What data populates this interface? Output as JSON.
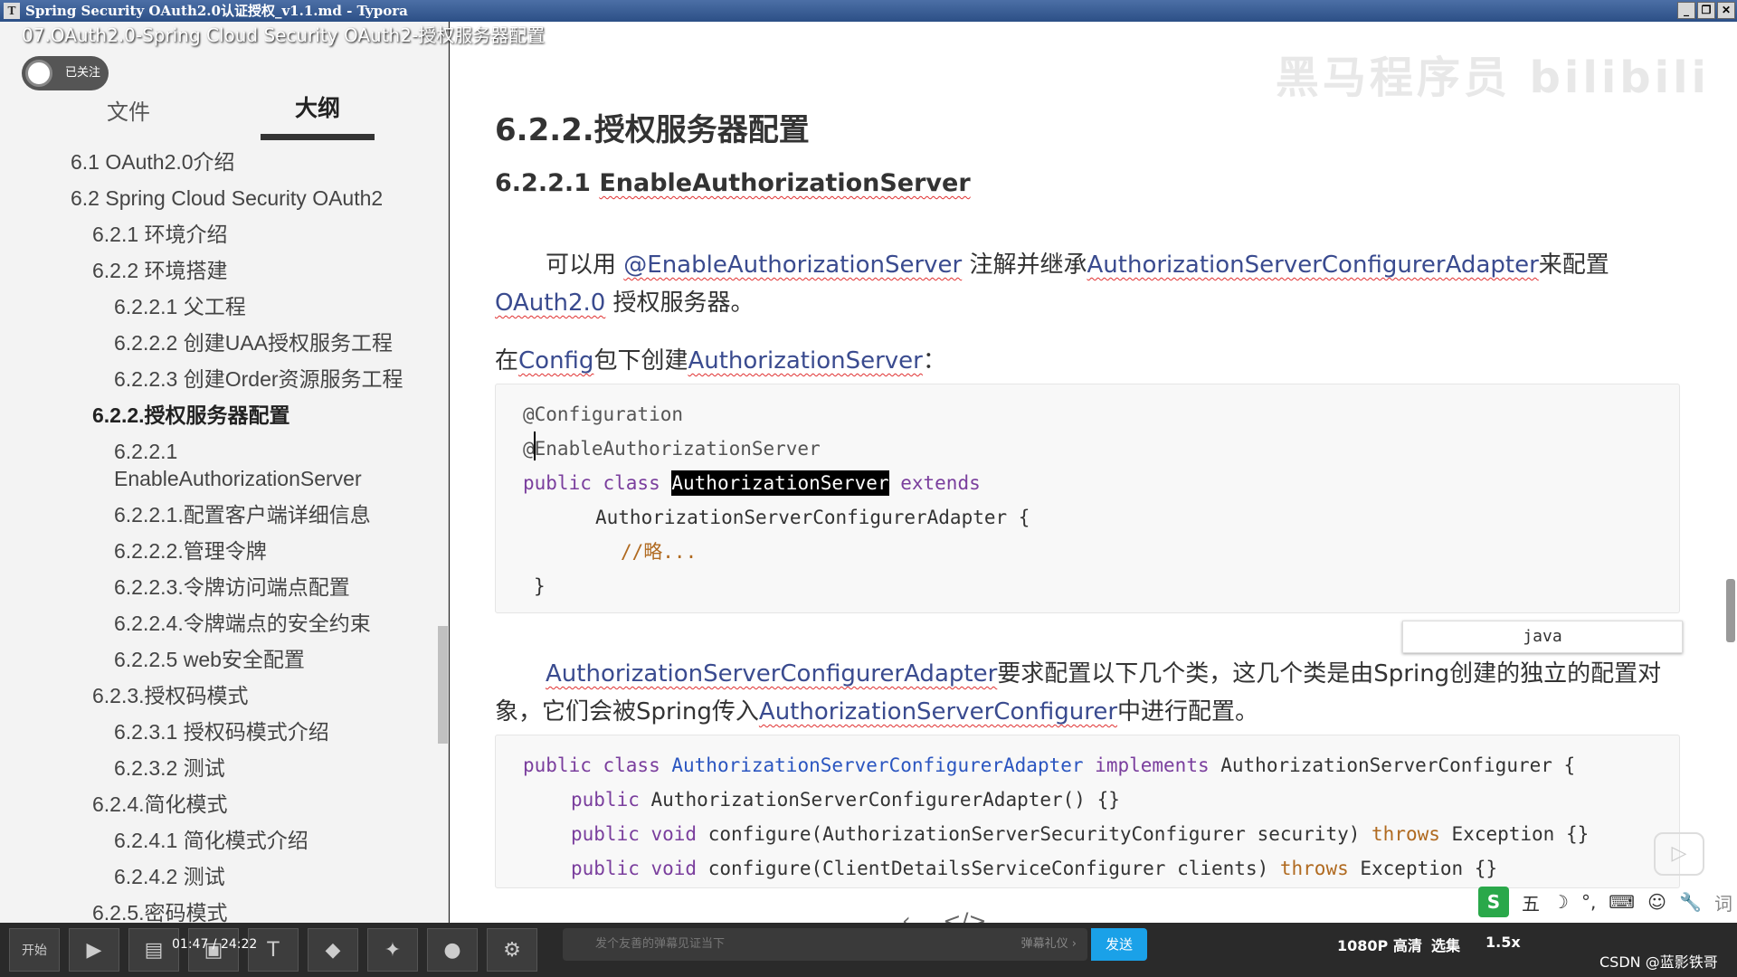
{
  "window": {
    "title": "Spring Security OAuth2.0认证授权_v1.1.md - Typora",
    "app_icon": "T"
  },
  "video_title": "07.OAuth2.0-Spring Cloud Security OAuth2-授权服务器配置",
  "follow": {
    "label": "已关注"
  },
  "sidebar": {
    "tab_file": "文件",
    "tab_outline": "大纲",
    "items": [
      {
        "label": "6.1 OAuth2.0介绍",
        "level": 1
      },
      {
        "label": "6.2 Spring Cloud Security OAuth2",
        "level": 1
      },
      {
        "label": "6.2.1 环境介绍",
        "level": 2
      },
      {
        "label": "6.2.2 环境搭建",
        "level": 2
      },
      {
        "label": "6.2.2.1 父工程",
        "level": 3
      },
      {
        "label": "6.2.2.2 创建UAA授权服务工程",
        "level": 3
      },
      {
        "label": "6.2.2.3 创建Order资源服务工程",
        "level": 3
      },
      {
        "label": "6.2.2.授权服务器配置",
        "level": 2,
        "active": true
      },
      {
        "label": "6.2.2.1",
        "level": 3
      },
      {
        "label": "EnableAuthorizationServer",
        "level": 3
      },
      {
        "label": "6.2.2.1.配置客户端详细信息",
        "level": 3
      },
      {
        "label": "6.2.2.2.管理令牌",
        "level": 3
      },
      {
        "label": "6.2.2.3.令牌访问端点配置",
        "level": 3
      },
      {
        "label": "6.2.2.4.令牌端点的安全约束",
        "level": 3
      },
      {
        "label": "6.2.2.5 web安全配置",
        "level": 3
      },
      {
        "label": "6.2.3.授权码模式",
        "level": 2
      },
      {
        "label": "6.2.3.1 授权码模式介绍",
        "level": 3
      },
      {
        "label": "6.2.3.2 测试",
        "level": 3
      },
      {
        "label": "6.2.4.简化模式",
        "level": 2
      },
      {
        "label": "6.2.4.1 简化模式介绍",
        "level": 3
      },
      {
        "label": "6.2.4.2 测试",
        "level": 3
      },
      {
        "label": "6.2.5.密码模式",
        "level": 2
      }
    ]
  },
  "doc": {
    "h1": "6.2.2.授权服务器配置",
    "h2_num": "6.2.2.1 ",
    "h2_name": "EnableAuthorizationServer",
    "p1": {
      "a": "可以用 ",
      "b": "@EnableAuthorizationServer",
      "c": " 注解并继承",
      "d": "AuthorizationServerConfigurerAdapter",
      "e": "来配置"
    },
    "p1b": {
      "a": "OAuth2.0",
      "b": " 授权服务器。"
    },
    "p2": {
      "a": "在",
      "b": "Config",
      "c": "包下创建",
      "d": "AuthorizationServer",
      "e": "："
    },
    "code1": {
      "l1": "@Configuration",
      "l2": "@EnableAuthorizationServer",
      "l3_kw": "public class ",
      "l3_cls": "AuthorizationServer",
      "l3_ext": " extends",
      "l4": "AuthorizationServerConfigurerAdapter {",
      "l5": "//略...",
      "l6": "}"
    },
    "lang_label": "java",
    "p3": {
      "a": "AuthorizationServerConfigurerAdapter",
      "b": "要求配置以下几个类，这几个类是由Sp",
      "c": "ring创建的独立的配置对"
    },
    "p3b": {
      "a": "象，它们会被Spring传入",
      "b": "AuthorizationServerConfigurer",
      "c": "中进行配置。"
    },
    "code2": {
      "l1_kw": "public class ",
      "l1_cls": "AuthorizationServerConfigurerAdapter",
      "l1_impl": " implements ",
      "l1_rest": "AuthorizationServerConfigurer {",
      "l2_kw": "public ",
      "l2_rest": "AuthorizationServerConfigurerAdapter() {}",
      "l3_kw": "public void ",
      "l3_rest": "configure(AuthorizationServerSecurityConfigurer security) ",
      "l3_throws": "throws",
      "l3_end": " Exception {}",
      "l4_kw": "public void ",
      "l4_rest": "configure(ClientDetailsServiceConfigurer clients) ",
      "l4_throws": "throws",
      "l4_end": " Exception {}"
    }
  },
  "watermark": "黑马程序员 bilibili",
  "ime": {
    "s": "S",
    "wu": "五",
    "ci": "词"
  },
  "player": {
    "time": "01:47 / 24:22",
    "danmu_placeholder": "发个友善的弹幕见证当下",
    "danmu_etiquette": "弹幕礼仪 ›",
    "send": "发送",
    "quality": "1080P 高清",
    "episodes": "选集",
    "speed": "1.5x",
    "start": "开始",
    "credit": "CSDN @蓝影铁哥"
  }
}
